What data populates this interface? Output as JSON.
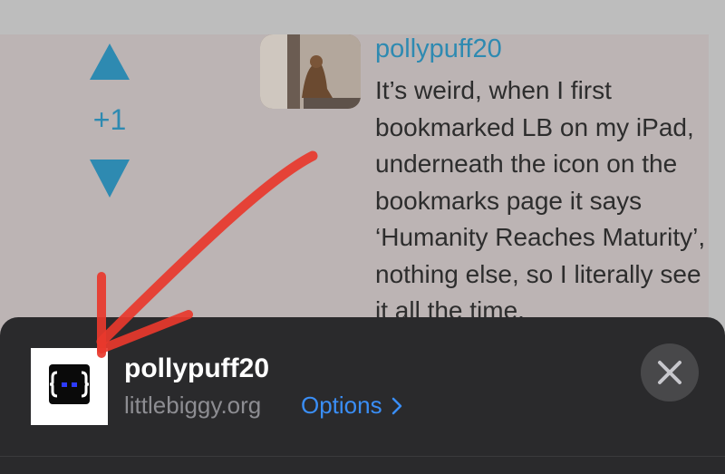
{
  "comment": {
    "vote_count": "+1",
    "username": "pollypuff20",
    "body": "It’s weird, when I first bookmarked LB on my iPad, underneath the icon on the bookmarks page it says ‘Humanity Reaches Maturity’, nothing else, so I literally see it all the time."
  },
  "banner": {
    "title": "pollypuff20",
    "domain": "littlebiggy.org",
    "options_label": "Options"
  },
  "icons": {
    "upvote": "triangle-up-icon",
    "downvote": "triangle-down-icon",
    "app": "site-logo-icon",
    "options": "chevron-right-icon",
    "close": "close-icon",
    "annotation": "red-arrow"
  },
  "colors": {
    "accent": "#2e8ab1",
    "link": "#3a8ef6",
    "annotation": "#e8382c"
  }
}
